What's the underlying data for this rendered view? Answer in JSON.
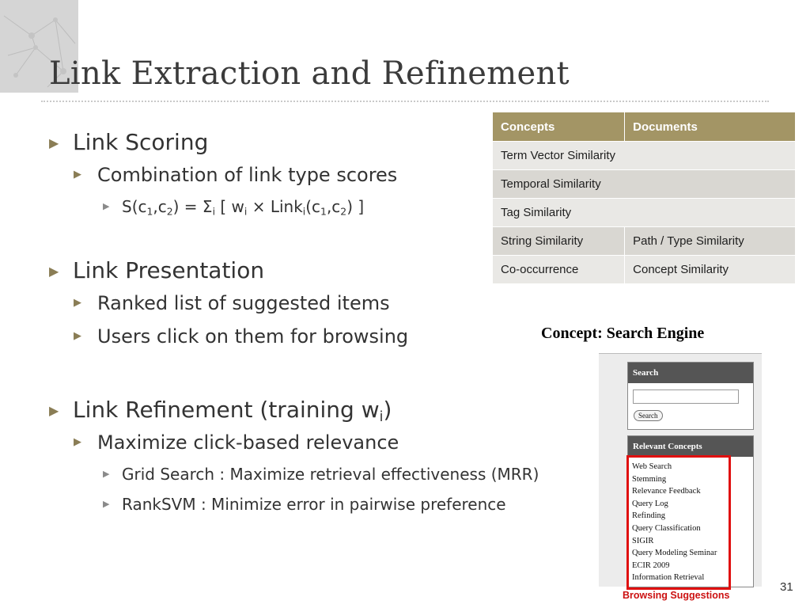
{
  "slide": {
    "title": "Link Extraction and Refinement",
    "page_number": "31"
  },
  "bullets": {
    "scoring": {
      "heading": "Link Scoring",
      "sub1": "Combination of link type scores",
      "formula": {
        "prefix": "S(c",
        "sub_c1": "1",
        "comma": ",c",
        "sub_c2": "2",
        "eq": ") = Σ",
        "sub_i": "i",
        "w": " [ w",
        "sub_i2": "i",
        "link": " × Link",
        "sub_i3": "i",
        "args": "(c",
        "sub_c1b": "1",
        "comma2": ",c",
        "sub_c2b": "2",
        "close": ") ]"
      }
    },
    "presentation": {
      "heading": "Link Presentation",
      "items": [
        "Ranked list of suggested items",
        "Users click on them for browsing"
      ]
    },
    "refinement": {
      "heading_prefix": "Link Refinement (training w",
      "heading_sub": "i",
      "heading_suffix": ")",
      "sub1": "Maximize click-based relevance",
      "items": [
        "Grid Search : Maximize retrieval effectiveness (MRR)",
        "RankSVM : Minimize error in pairwise preference"
      ]
    }
  },
  "table": {
    "headers": [
      "Concepts",
      "Documents"
    ],
    "rows": [
      [
        "Term Vector Similarity",
        ""
      ],
      [
        "Temporal Similarity",
        ""
      ],
      [
        "Tag Similarity",
        ""
      ],
      [
        "String Similarity",
        "Path / Type Similarity"
      ],
      [
        "Co-occurrence",
        "Concept Similarity"
      ]
    ]
  },
  "screenshot": {
    "caption": "Concept: Search Engine",
    "search_header": "Search",
    "search_button": "Search",
    "search_value": "",
    "relevant_header": "Relevant Concepts",
    "suggestions": [
      "Web Search",
      "Stemming",
      "Relevance Feedback",
      "Query Log",
      "Refinding",
      "Query Classification",
      "SIGIR",
      "Query Modeling Seminar",
      "ECIR 2009",
      "Information Retrieval"
    ],
    "highlight_caption": "Browsing Suggestions"
  },
  "colors": {
    "accent": "#a39565",
    "highlight": "#e01010"
  }
}
